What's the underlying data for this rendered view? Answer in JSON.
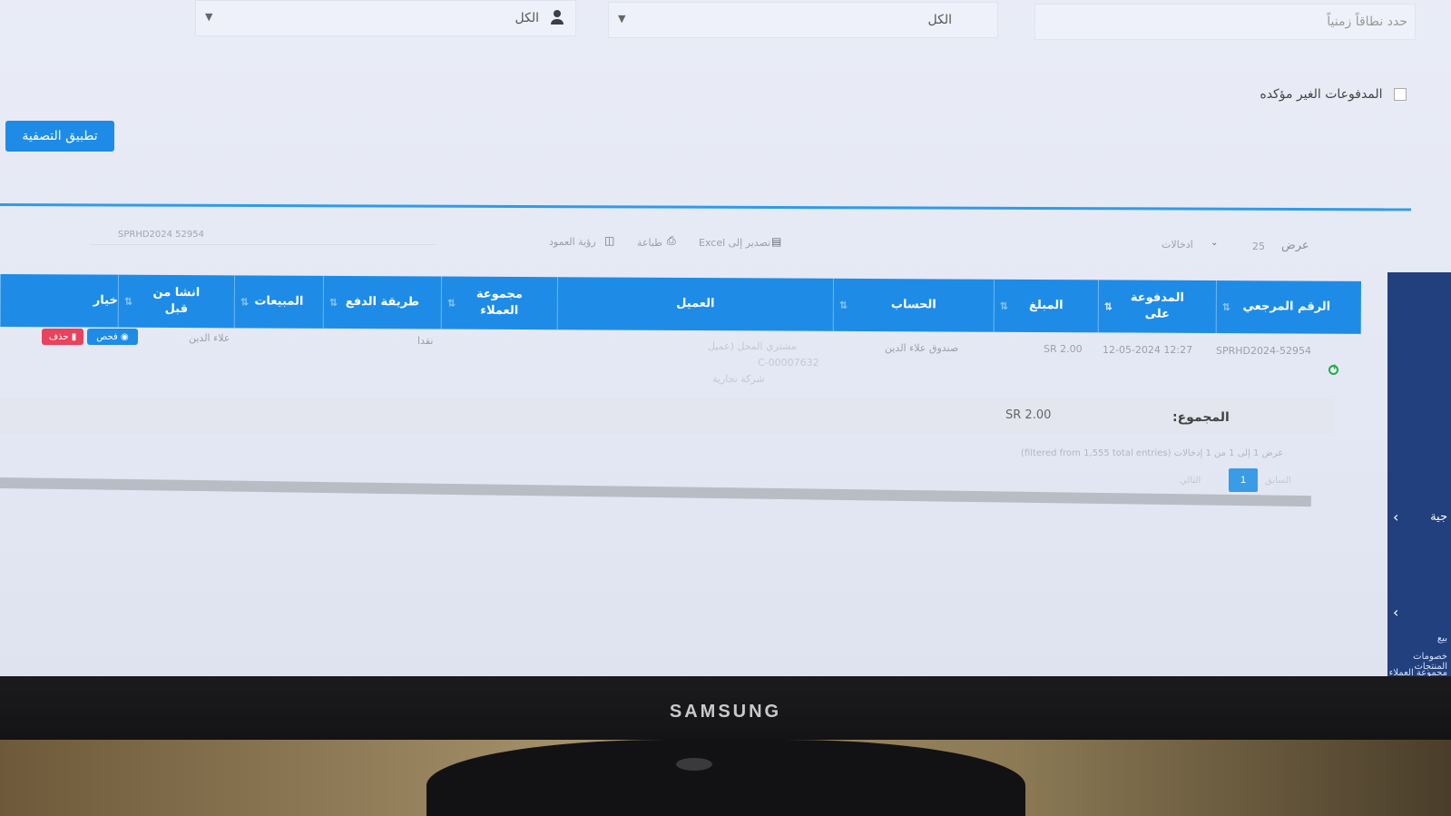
{
  "filters": {
    "date_placeholder": "حدد نطاقاً زمنياً",
    "account_select": "الكل",
    "user_select": "الكل",
    "unconfirmed_label": "المدفوعات الغير مؤكده",
    "apply_button": "تطبيق التصفية"
  },
  "toolbar": {
    "show_label": "عرض",
    "page_size": "25",
    "entries_label": "ادخالات",
    "export_excel": "تصدير إلى Excel",
    "print": "طباعة",
    "column_visibility": "رؤية العمود",
    "search_value": "SPRHD2024 52954"
  },
  "table": {
    "columns": [
      {
        "key": "ref",
        "label": "الرقم المرجعي"
      },
      {
        "key": "paid_on",
        "label": "المدفوعة على"
      },
      {
        "key": "amount",
        "label": "المبلغ"
      },
      {
        "key": "account",
        "label": "الحساب"
      },
      {
        "key": "customer",
        "label": "العميل"
      },
      {
        "key": "customer_group",
        "label": "مجموعة العملاء"
      },
      {
        "key": "payment_method",
        "label": "طريقة الدفع"
      },
      {
        "key": "sales",
        "label": "المبيعات"
      },
      {
        "key": "created_by",
        "label": "انشا من قبل"
      },
      {
        "key": "options",
        "label": "خيار"
      }
    ],
    "rows": [
      {
        "ref": "SPRHD2024-52954",
        "paid_on": "12-05-2024 12:27",
        "amount": "SR 2.00",
        "account": "صندوق علاء الدين",
        "customer_line1": "مشتري المحل (عميل",
        "customer_line2": "C-00007632",
        "customer_line3": "شركة تجارية",
        "payment_method": "نقدا",
        "created_by": "علاء الدين",
        "view_button": "فحص",
        "delete_button": "حذف"
      }
    ],
    "total_label": "المجموع:",
    "total_amount": "SR 2.00"
  },
  "pagination": {
    "info": "عرض 1 إلى 1 من 1 إدخالات (filtered from 1,555 total entries)",
    "previous": "السابق",
    "current_page": "1",
    "next": "التالي"
  },
  "monitor": {
    "brand": "SAMSUNG"
  },
  "sidebar": {
    "item1": "بيع",
    "item2": "خصومات المنتجات",
    "item3": "مجموعة العملاء",
    "item4": "جية"
  },
  "colors": {
    "primary": "#1e8ce6",
    "danger": "#e8425c",
    "success": "#22a84a",
    "sidebar": "#23407e"
  }
}
